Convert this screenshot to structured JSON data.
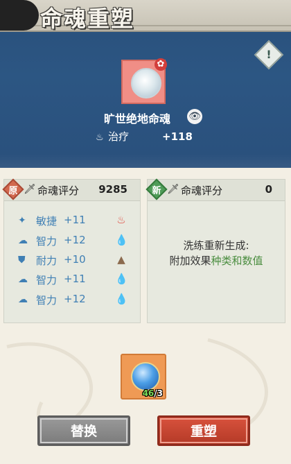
{
  "header": {
    "title": "命魂重塑",
    "info_icon": "!"
  },
  "item": {
    "name": "旷世绝地命魂",
    "icon": "soul-orb-icon",
    "attribute": {
      "icon": "heal-icon",
      "label": "治疗",
      "value": "+118"
    }
  },
  "original": {
    "badge": "原",
    "label": "命魂评分",
    "score": "9285",
    "stats": [
      {
        "icon": "agility-icon",
        "glyph": "✦",
        "name": "敏捷",
        "value": "+11",
        "element": "fire-icon",
        "element_glyph": "♨",
        "element_color": "#e0463c"
      },
      {
        "icon": "intellect-icon",
        "glyph": "☁",
        "name": "智力",
        "value": "+12",
        "element": "water-icon",
        "element_glyph": "💧",
        "element_color": "#3f8fd0"
      },
      {
        "icon": "stamina-icon",
        "glyph": "⛊",
        "name": "耐力",
        "value": "+10",
        "element": "earth-icon",
        "element_glyph": "▲",
        "element_color": "#8b6a4e"
      },
      {
        "icon": "intellect-icon",
        "glyph": "☁",
        "name": "智力",
        "value": "+11",
        "element": "water-icon",
        "element_glyph": "💧",
        "element_color": "#3f8fd0"
      },
      {
        "icon": "intellect-icon",
        "glyph": "☁",
        "name": "智力",
        "value": "+12",
        "element": "water-icon",
        "element_glyph": "💧",
        "element_color": "#3f8fd0"
      }
    ]
  },
  "new": {
    "badge": "新",
    "label": "命魂评分",
    "score": "0",
    "line1": "洗练重新生成:",
    "line2_prefix": "附加效果",
    "line2_highlight": "种类和数值"
  },
  "consumable": {
    "have": "46",
    "need": "/3"
  },
  "buttons": {
    "replace": "替换",
    "reforge": "重塑"
  }
}
